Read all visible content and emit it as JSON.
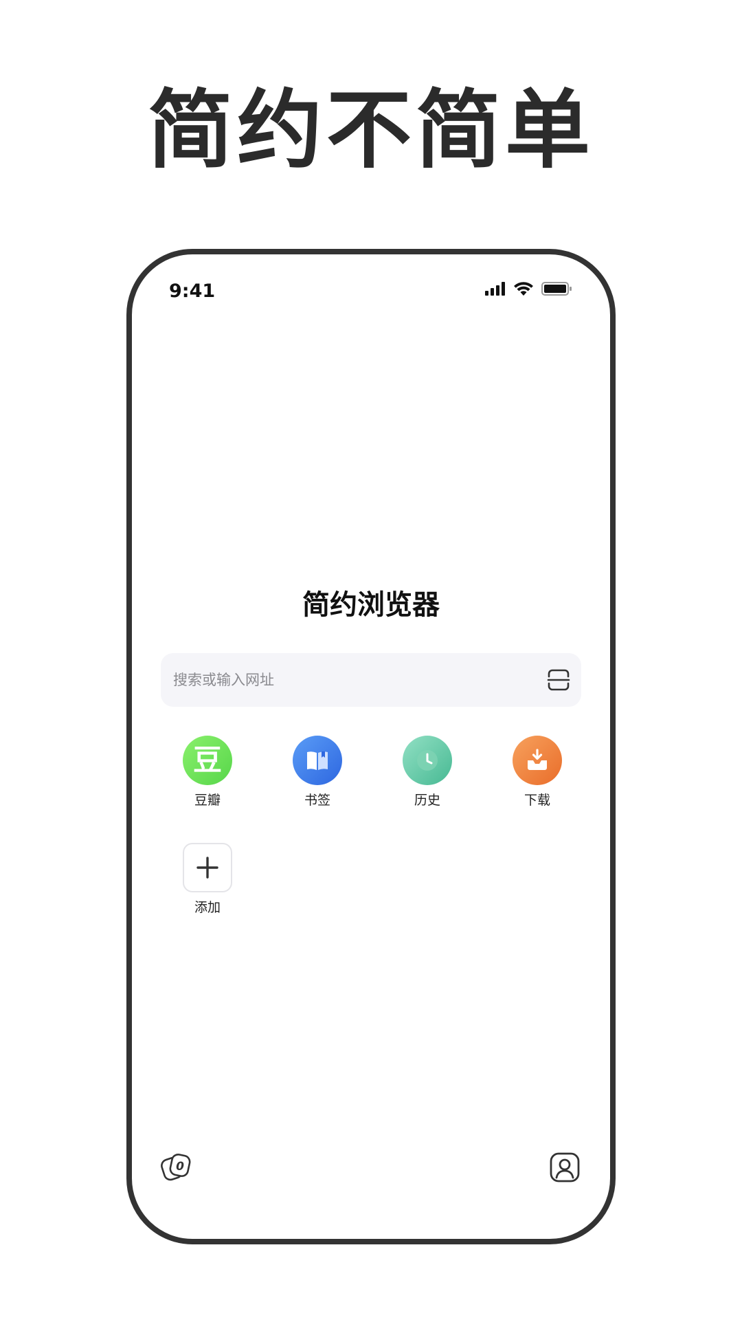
{
  "headline": "简约不简单",
  "status_bar": {
    "time": "9:41",
    "icons": [
      "signal-icon",
      "wifi-icon",
      "battery-icon"
    ]
  },
  "home": {
    "title": "简约浏览器",
    "search": {
      "placeholder": "搜索或输入网址",
      "scan_icon": "scan-icon"
    },
    "shortcuts": [
      {
        "label": "豆瓣",
        "icon": "douban-icon",
        "glyph": "豆",
        "color": "#5ad84b"
      },
      {
        "label": "书签",
        "icon": "bookmark-icon",
        "color": "#3a74e8"
      },
      {
        "label": "历史",
        "icon": "history-clock-icon",
        "color": "#58c29d"
      },
      {
        "label": "下载",
        "icon": "download-icon",
        "color": "#ee7a35"
      },
      {
        "label": "添加",
        "icon": "plus-icon",
        "color": "#333333"
      }
    ]
  },
  "bottom_bar": {
    "tabs_count": "0",
    "tabs_icon": "tabs-icon",
    "profile_icon": "profile-icon"
  },
  "colors": {
    "frame": "#333333",
    "search_background": "#f5f5f9",
    "placeholder_text": "#8a8a8f"
  }
}
